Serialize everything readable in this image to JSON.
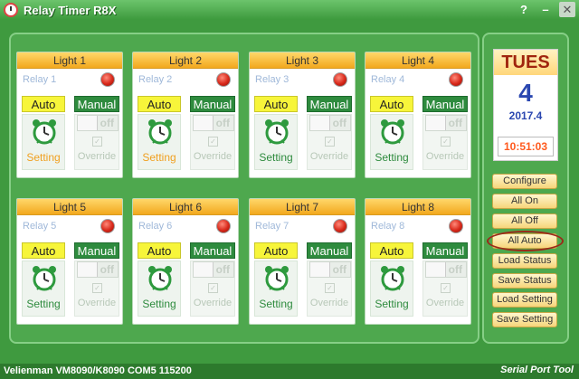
{
  "window": {
    "title": "Relay Timer R8X",
    "help_btn": "?",
    "min_btn": "–",
    "close_btn": "✕"
  },
  "lights": [
    {
      "title": "Light 1",
      "relay": "Relay 1",
      "auto": "Auto",
      "manual": "Manual",
      "setting": "Setting",
      "setting_color": "orange",
      "toggle": "off",
      "override": "Override"
    },
    {
      "title": "Light 2",
      "relay": "Relay 2",
      "auto": "Auto",
      "manual": "Manual",
      "setting": "Setting",
      "setting_color": "orange",
      "toggle": "off",
      "override": "Override"
    },
    {
      "title": "Light 3",
      "relay": "Relay 3",
      "auto": "Auto",
      "manual": "Manual",
      "setting": "Setting",
      "setting_color": "green",
      "toggle": "off",
      "override": "Override"
    },
    {
      "title": "Light 4",
      "relay": "Relay 4",
      "auto": "Auto",
      "manual": "Manual",
      "setting": "Setting",
      "setting_color": "green",
      "toggle": "off",
      "override": "Override"
    },
    {
      "title": "Light 5",
      "relay": "Relay 5",
      "auto": "Auto",
      "manual": "Manual",
      "setting": "Setting",
      "setting_color": "green",
      "toggle": "off",
      "override": "Override"
    },
    {
      "title": "Light 6",
      "relay": "Relay 6",
      "auto": "Auto",
      "manual": "Manual",
      "setting": "Setting",
      "setting_color": "green",
      "toggle": "off",
      "override": "Override"
    },
    {
      "title": "Light 7",
      "relay": "Relay 7",
      "auto": "Auto",
      "manual": "Manual",
      "setting": "Setting",
      "setting_color": "green",
      "toggle": "off",
      "override": "Override"
    },
    {
      "title": "Light 8",
      "relay": "Relay 8",
      "auto": "Auto",
      "manual": "Manual",
      "setting": "Setting",
      "setting_color": "green",
      "toggle": "off",
      "override": "Override"
    }
  ],
  "calendar": {
    "weekday": "TUES",
    "day": "4",
    "month": "2017.4",
    "time": "10:51:03"
  },
  "side_buttons": [
    "Configure",
    "All On",
    "All Off",
    "All Auto",
    "Load Status",
    "Save Status",
    "Load Setting",
    "Save Setting"
  ],
  "status": {
    "text": "Velienman VM8090/K8090 COM5 115200",
    "brand": "Serial Port Tool"
  },
  "colors": {
    "accent": "#f2a81e",
    "led_red": "#d8281a",
    "manual_green": "#2e8b3e",
    "auto_yellow": "#f7f53a"
  }
}
